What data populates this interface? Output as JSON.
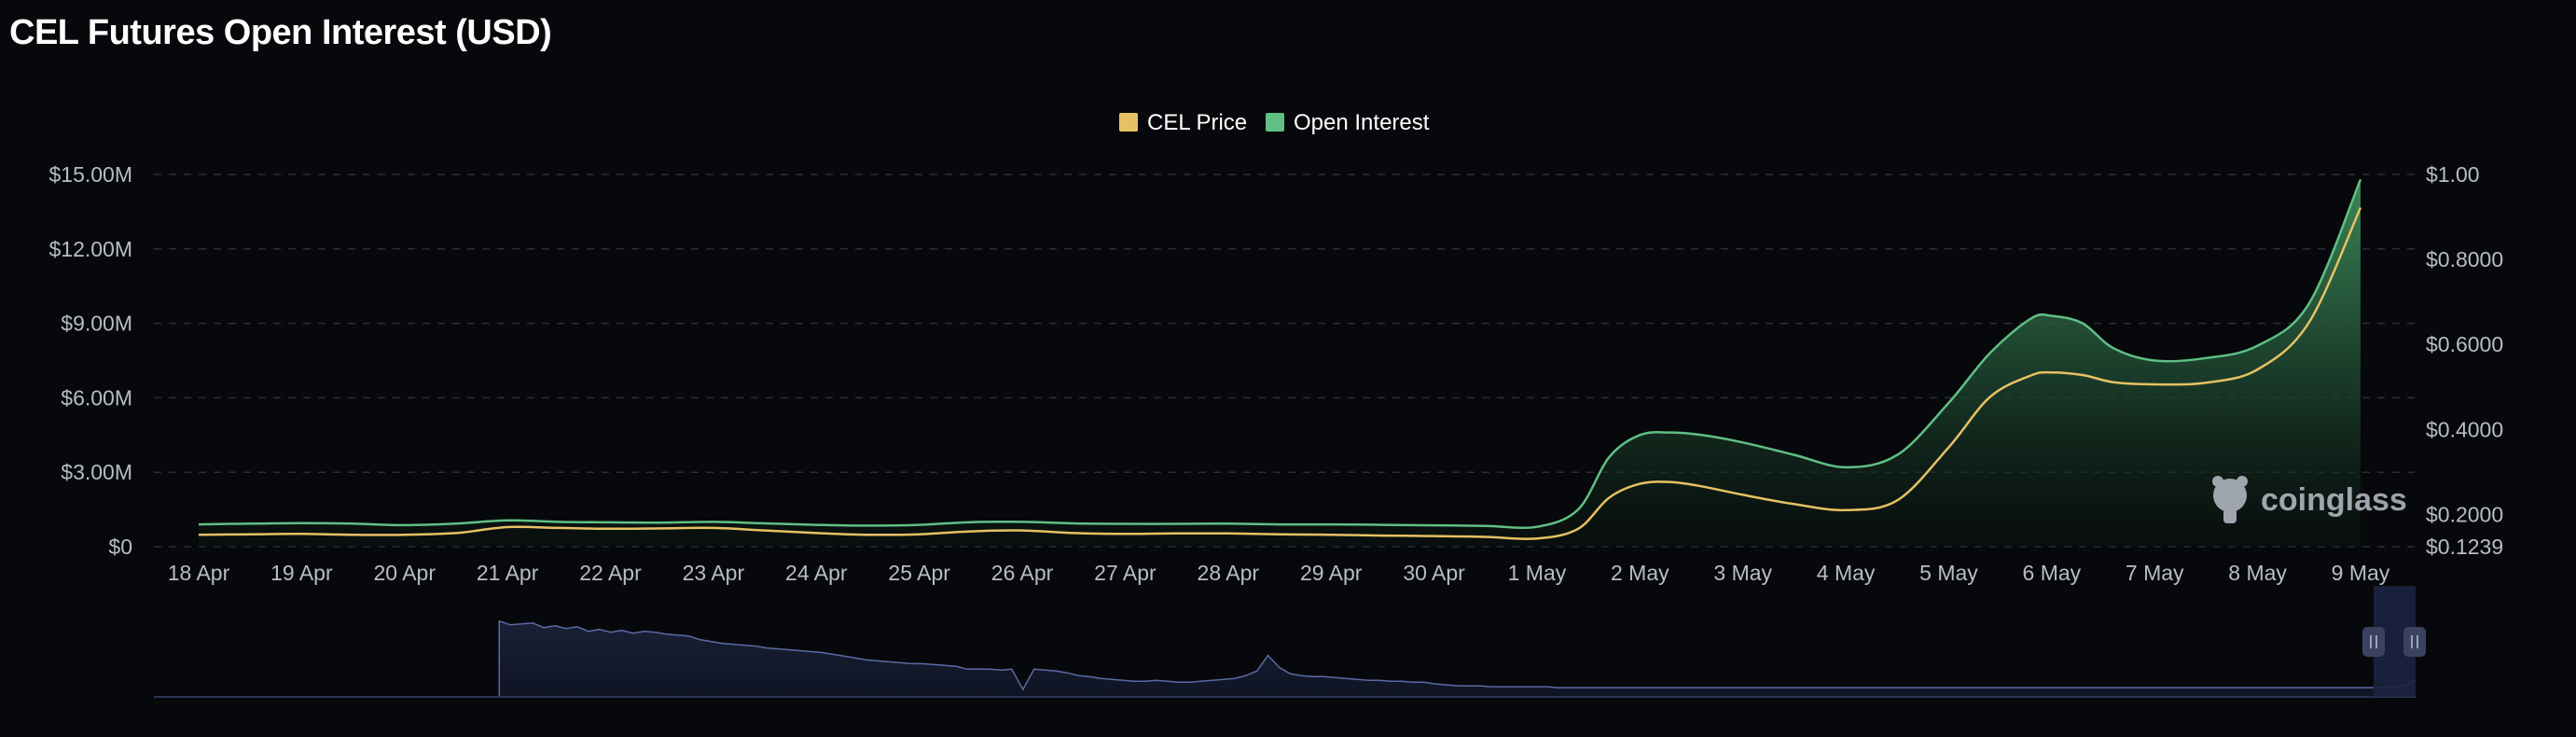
{
  "title": "CEL Futures Open Interest (USD)",
  "watermark": "coinglass",
  "colors": {
    "background": "#07080b",
    "price": "#e6c163",
    "open_interest": "#5fbf84",
    "navigator": "#5b6aa6"
  },
  "chart_data": {
    "type": "area",
    "title": "CEL Futures Open Interest (USD)",
    "legend_position": "top-center",
    "grid": true,
    "categories": [
      "18 Apr",
      "19 Apr",
      "20 Apr",
      "21 Apr",
      "22 Apr",
      "23 Apr",
      "24 Apr",
      "25 Apr",
      "26 Apr",
      "27 Apr",
      "28 Apr",
      "29 Apr",
      "30 Apr",
      "1 May",
      "2 May",
      "3 May",
      "4 May",
      "5 May",
      "6 May",
      "7 May",
      "8 May",
      "9 May"
    ],
    "y_left": {
      "ticks": [
        "$0",
        "$3.00M",
        "$6.00M",
        "$9.00M",
        "$12.00M",
        "$15.00M"
      ],
      "range": [
        0,
        15000000
      ]
    },
    "y_right": {
      "ticks": [
        "$0.1239",
        "$0.2000",
        "$0.4000",
        "$0.6000",
        "$0.8000",
        "$1.00"
      ],
      "range": [
        0.1239,
        1.0
      ]
    },
    "series": [
      {
        "name": "Open Interest",
        "axis": "left",
        "color": "#5fbf84",
        "x": [
          0,
          0.5,
          1,
          1.5,
          2,
          2.5,
          3,
          3.5,
          4,
          4.5,
          5,
          5.5,
          6,
          6.5,
          7,
          7.5,
          8,
          8.5,
          9,
          9.5,
          10,
          10.5,
          11,
          11.5,
          12,
          12.5,
          13,
          13.4,
          13.7,
          14,
          14.3,
          14.6,
          15,
          15.5,
          16,
          16.5,
          17,
          17.4,
          17.8,
          18,
          18.3,
          18.6,
          19,
          19.5,
          20,
          20.5,
          21
        ],
        "values": [
          900000,
          930000,
          950000,
          930000,
          870000,
          930000,
          1060000,
          1000000,
          980000,
          970000,
          1000000,
          940000,
          880000,
          850000,
          880000,
          990000,
          1000000,
          940000,
          920000,
          920000,
          930000,
          900000,
          900000,
          880000,
          860000,
          840000,
          800000,
          1500000,
          3600000,
          4500000,
          4600000,
          4500000,
          4200000,
          3700000,
          3200000,
          3700000,
          5800000,
          7800000,
          9200000,
          9300000,
          9000000,
          8000000,
          7500000,
          7600000,
          8100000,
          9800000,
          14800000
        ]
      },
      {
        "name": "CEL Price",
        "axis": "right",
        "color": "#e6c163",
        "x": [
          0,
          0.5,
          1,
          1.5,
          2,
          2.5,
          3,
          3.5,
          4,
          4.5,
          5,
          5.5,
          6,
          6.5,
          7,
          7.5,
          8,
          8.5,
          9,
          9.5,
          10,
          10.5,
          11,
          11.5,
          12,
          12.5,
          13,
          13.4,
          13.7,
          14,
          14.3,
          14.6,
          15,
          15.5,
          16,
          16.5,
          17,
          17.4,
          17.8,
          18,
          18.3,
          18.6,
          19,
          19.5,
          20,
          20.5,
          21
        ],
        "values": [
          0.152,
          0.153,
          0.154,
          0.152,
          0.152,
          0.156,
          0.17,
          0.168,
          0.166,
          0.167,
          0.168,
          0.162,
          0.156,
          0.152,
          0.153,
          0.16,
          0.162,
          0.156,
          0.154,
          0.155,
          0.155,
          0.153,
          0.152,
          0.15,
          0.149,
          0.147,
          0.143,
          0.166,
          0.239,
          0.272,
          0.276,
          0.266,
          0.246,
          0.224,
          0.21,
          0.233,
          0.358,
          0.476,
          0.527,
          0.534,
          0.528,
          0.511,
          0.506,
          0.51,
          0.541,
          0.652,
          0.922
        ]
      }
    ],
    "navigator_series": [
      0,
      0,
      0,
      0,
      0,
      0,
      0,
      0,
      0,
      0,
      0,
      0,
      0,
      0,
      0,
      0,
      0,
      0,
      0,
      0,
      0,
      0,
      0,
      0,
      0,
      0,
      0,
      0,
      0,
      0,
      0,
      0.82,
      0.78,
      0.79,
      0.8,
      0.75,
      0.77,
      0.74,
      0.76,
      0.71,
      0.73,
      0.7,
      0.72,
      0.69,
      0.71,
      0.7,
      0.68,
      0.67,
      0.66,
      0.62,
      0.6,
      0.58,
      0.57,
      0.56,
      0.55,
      0.53,
      0.52,
      0.51,
      0.5,
      0.49,
      0.48,
      0.46,
      0.44,
      0.42,
      0.4,
      0.39,
      0.38,
      0.37,
      0.36,
      0.36,
      0.35,
      0.34,
      0.33,
      0.3,
      0.3,
      0.3,
      0.29,
      0.3,
      0.08,
      0.3,
      0.29,
      0.28,
      0.26,
      0.23,
      0.22,
      0.2,
      0.19,
      0.18,
      0.17,
      0.17,
      0.18,
      0.17,
      0.16,
      0.16,
      0.17,
      0.18,
      0.19,
      0.2,
      0.23,
      0.28,
      0.45,
      0.32,
      0.25,
      0.23,
      0.22,
      0.22,
      0.21,
      0.2,
      0.19,
      0.18,
      0.18,
      0.17,
      0.17,
      0.16,
      0.16,
      0.14,
      0.13,
      0.12,
      0.12,
      0.12,
      0.11,
      0.11,
      0.11,
      0.11,
      0.11,
      0.11,
      0.1,
      0.1,
      0.1,
      0.1,
      0.1,
      0.1,
      0.1,
      0.1,
      0.1,
      0.1,
      0.1,
      0.1,
      0.1,
      0.1,
      0.1,
      0.1,
      0.1,
      0.1,
      0.1,
      0.1,
      0.1,
      0.1,
      0.1,
      0.1,
      0.1,
      0.1,
      0.1,
      0.1,
      0.1,
      0.1,
      0.1,
      0.1,
      0.1,
      0.1,
      0.1,
      0.1,
      0.1,
      0.1,
      0.1,
      0.1,
      0.1,
      0.1,
      0.1,
      0.1,
      0.1,
      0.1,
      0.1,
      0.1,
      0.1,
      0.1,
      0.1,
      0.1,
      0.1,
      0.1,
      0.1,
      0.1,
      0.1,
      0.1,
      0.1,
      0.1,
      0.1,
      0.1,
      0.1,
      0.1,
      0.1,
      0.1,
      0.1,
      0.1,
      0.1,
      0.1,
      0.1,
      0.1,
      0.1,
      0.1,
      0.1,
      0.11,
      0.12,
      0.18
    ]
  }
}
